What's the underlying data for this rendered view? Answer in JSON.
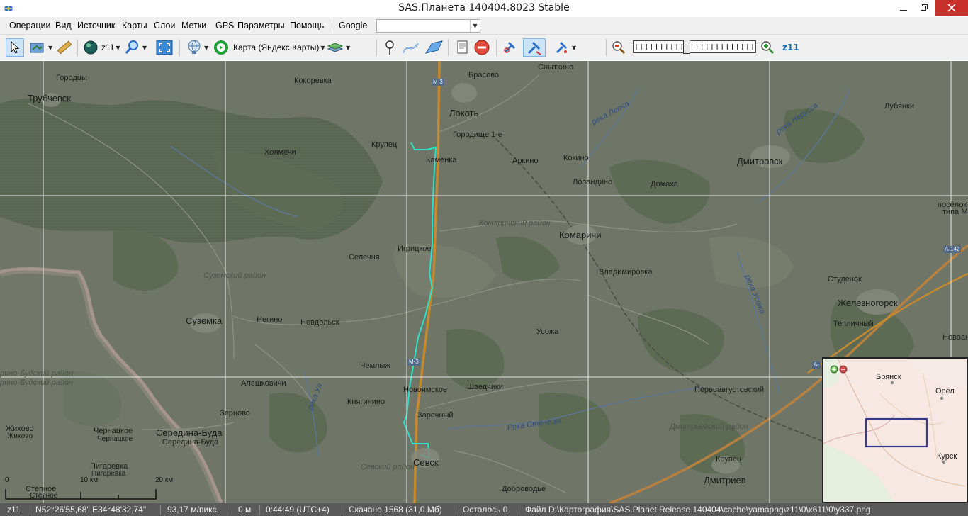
{
  "window": {
    "title": "SAS.Планета 140404.8023 Stable"
  },
  "menu": {
    "items": [
      "Операции",
      "Вид",
      "Источник",
      "Карты",
      "Слои",
      "Метки",
      "GPS",
      "Параметры",
      "Помощь"
    ],
    "source": "Google",
    "search_value": ""
  },
  "toolbar": {
    "zoom_button": "z11",
    "map_name": "Карта (Яндекс.Карты)",
    "zoom_level": "z11",
    "zoom_slider_fraction": 0.43
  },
  "map": {
    "labels": {
      "gorody": "Городцы",
      "trubchevsk": "Трубчевск",
      "kokorevka": "Кокоревка",
      "krupets1": "Крупец",
      "kholmechi": "Холмечи",
      "brasovo": "Брасово",
      "snytkino": "Сныткино",
      "lokot": "Локоть",
      "goroditshe": "Городище 1-е",
      "kamenka": "Каменка",
      "arkino": "Аркино",
      "kokino": "Кокино",
      "lopandino": "Лопандино",
      "domakha": "Домаха",
      "dmitrovsk": "Дмитровск",
      "lubyanki": "Лубянки",
      "poselok": "посёлок",
      "tipa": "типа М",
      "igritskoe": "Игрицкое",
      "selechnya": "Селечня",
      "komarichi": "Комаричи",
      "vladimirovka": "Владимировка",
      "studenok": "Студенок",
      "zheleznogorsk": "Железногорск",
      "suzemka": "Сузёмка",
      "negino": "Негино",
      "nevdolsk": "Невдольск",
      "usozha": "Усожа",
      "teplichny": "Тепличный",
      "novoe": "Новоан",
      "chemlyzh": "Чемлыж",
      "aleshkovichi": "Алешковичи",
      "novoyamskoe": "Новоямское",
      "shvedchiki": "Шведчики",
      "pervoavgustovsky": "Первоавгустовский",
      "knyaginino": "Княгинино",
      "zarechny": "Заречный",
      "zernovo": "Зерново",
      "zhikhovo1": "Жихово",
      "zhikhovo2": "Жихово",
      "chernatskoe1": "Чернацкое",
      "chernatskoe2": "Чернацкое",
      "sereda1": "Середина-Буда",
      "sereda2": "Середина-Буда",
      "pigarevka1": "Пигаревка",
      "pigarevka2": "Пигаревка",
      "stepnoe1": "Степное",
      "stepnoe2": "Степное",
      "sevsk": "Севск",
      "krupets2": "Крупец",
      "dmitriev": "Дмитриев",
      "dobrovodye": "Доброводье"
    },
    "regions": {
      "komarichsky": "Комаричский район",
      "suzemsky": "Суземский район",
      "sevsky": "Севский район",
      "dmitrievsky": "Дмитриевский район",
      "budsky1": "рино-Будский район",
      "budsky2": "рино-Будский район"
    },
    "rivers": {
      "lepcha": "река Лепча",
      "nerussa": "река Нерусса",
      "usozha": "река Усожа",
      "uly": "река Ул",
      "sten": "река Стене ва",
      "stenatext": "Река Стене.ва"
    },
    "shields": {
      "m3_top": "М-3",
      "m3_mid": "М-3",
      "a142": "А-142",
      "a_edge": "А-"
    },
    "scale": {
      "zero": "0",
      "ten": "10 км",
      "twenty": "20 км"
    }
  },
  "minimap": {
    "labels": {
      "bryansk": "Брянск",
      "orel": "Орел",
      "kursk": "Курск"
    }
  },
  "status": {
    "zoom": "z11",
    "coords": "N52°26'55,68\" E34°48'32,74\"",
    "resolution": "93,17 м/пикс.",
    "distance": "0 м",
    "time": "0:44:49 (UTC+4)",
    "downloaded": "Скачано 1568 (31,0 Мб)",
    "remaining": "Осталось 0",
    "file": "Файл D:\\Картография\\SAS.Planet.Release.140404\\cache\\yamapng\\z11\\0\\x611\\0\\y337.png"
  },
  "colors": {
    "map_base": "#6e7566",
    "forest": "#5b6a52",
    "route": "#2fe0c8",
    "highway": "#c98a2a",
    "grid": "#e8e8e8",
    "minimap_frame": "#3a3a8a"
  }
}
